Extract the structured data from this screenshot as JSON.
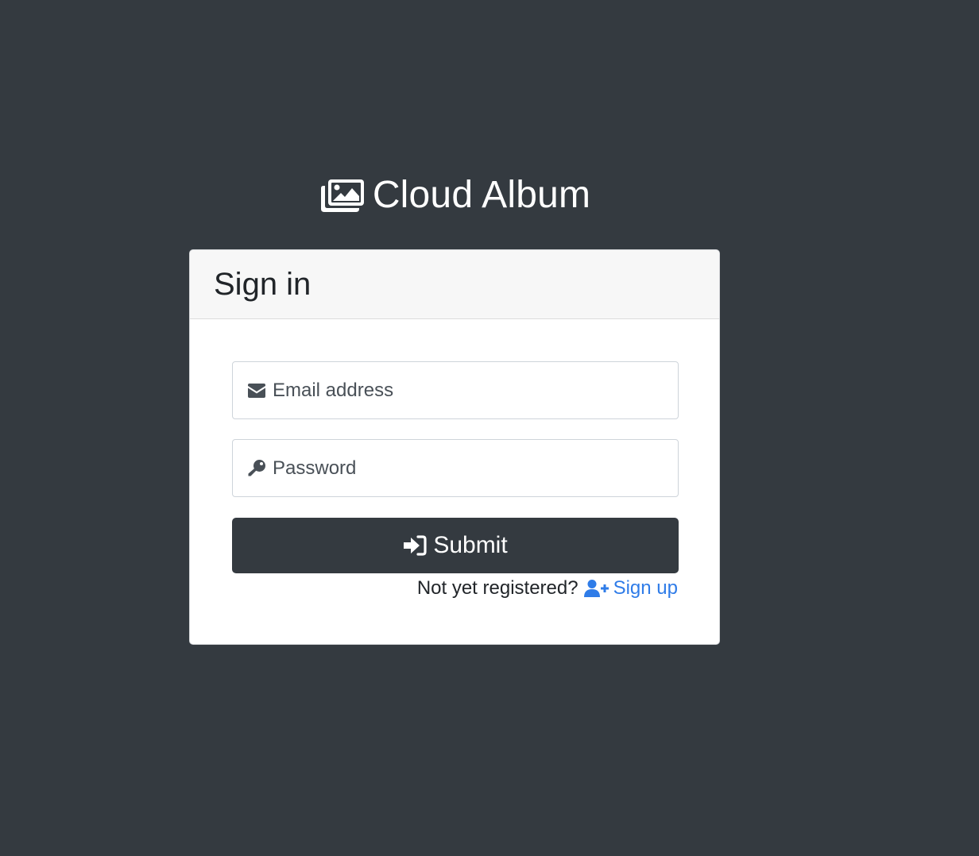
{
  "app": {
    "title": "Cloud Album",
    "brand_icon": "images-icon"
  },
  "card": {
    "title": "Sign in"
  },
  "form": {
    "email": {
      "placeholder": "Email address",
      "value": "",
      "icon": "envelope-icon"
    },
    "password": {
      "placeholder": "Password",
      "value": "",
      "icon": "key-icon"
    },
    "submit": {
      "label": "Submit",
      "icon": "sign-in-icon"
    }
  },
  "signup": {
    "prompt": "Not yet registered?",
    "link_label": "Sign up",
    "icon": "user-plus-icon"
  },
  "colors": {
    "background": "#343a40",
    "button": "#343a40",
    "link": "#2f7ce8",
    "card_header": "#f7f7f7"
  }
}
